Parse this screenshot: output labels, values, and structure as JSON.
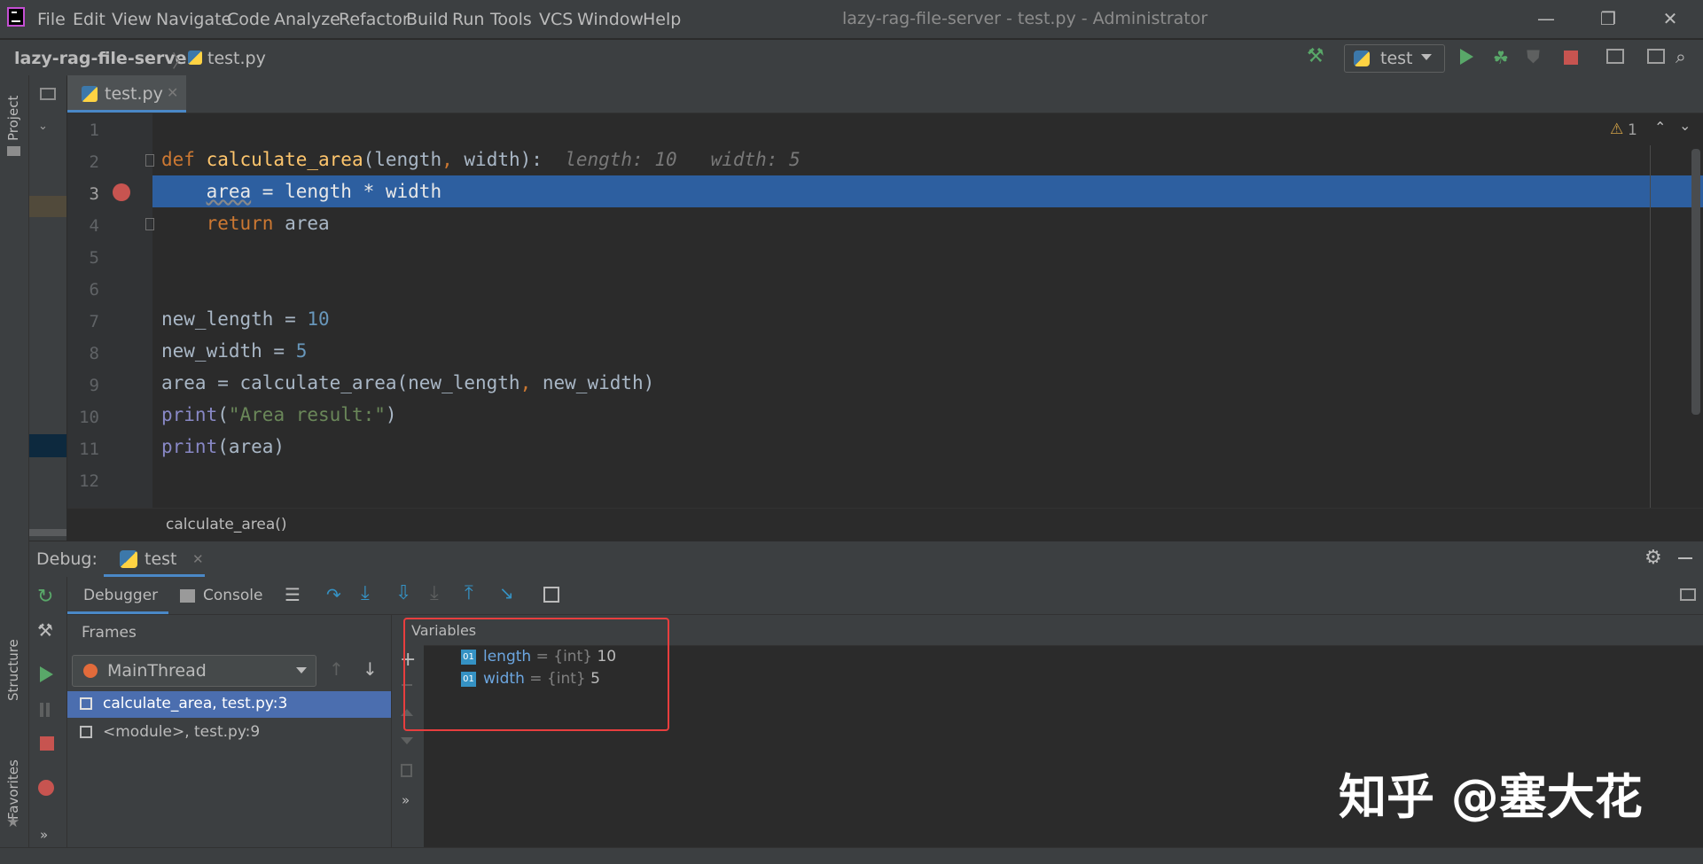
{
  "menu": [
    "File",
    "Edit",
    "View",
    "Navigate",
    "Code",
    "Analyze",
    "Refactor",
    "Build",
    "Run",
    "Tools",
    "VCS",
    "Window",
    "Help"
  ],
  "window_title": "lazy-rag-file-server - test.py - Administrator",
  "breadcrumb": {
    "project": "lazy-rag-file-server",
    "file": "test.py"
  },
  "run_config": "test",
  "editor": {
    "tab": "test.py",
    "line_numbers": [
      "1",
      "2",
      "3",
      "4",
      "5",
      "6",
      "7",
      "8",
      "9",
      "10",
      "11",
      "12"
    ],
    "inline_hint": "length: 10   width: 5",
    "warning_count": "1",
    "current_line": "3",
    "function_breadcrumb": "calculate_area()"
  },
  "side_labels": {
    "project": "Project",
    "structure": "Structure",
    "favorites": "Favorites"
  },
  "debug": {
    "title": "Debug:",
    "session": "test",
    "tabs": {
      "debugger": "Debugger",
      "console": "Console"
    },
    "frames_header": "Frames",
    "thread": "MainThread",
    "frames": [
      "calculate_area, test.py:3",
      "<module>, test.py:9"
    ],
    "variables_header": "Variables",
    "variables": [
      {
        "name": "length",
        "type": "{int}",
        "value": "10"
      },
      {
        "name": "width",
        "type": "{int}",
        "value": "5"
      }
    ]
  },
  "watermark": "知乎 @塞大花",
  "colors": {
    "accent": "#4a88c7",
    "exec_line": "#2d5fa0",
    "breakpoint": "#c75450",
    "highlight": "#e83e3e"
  }
}
